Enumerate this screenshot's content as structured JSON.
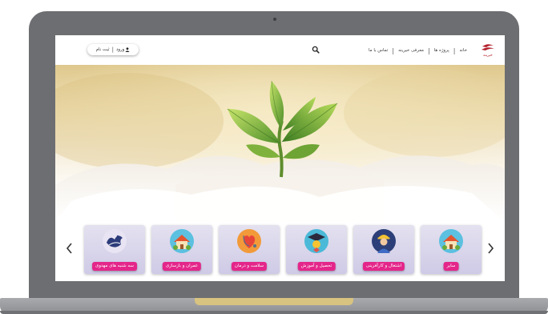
{
  "header": {
    "nav": {
      "home": "خانه",
      "projects": "پروژه ها",
      "about": "معرفی خیرینه",
      "contact": "تماس با ما"
    },
    "auth": {
      "login": "ورود",
      "separator": "|",
      "register": "ثبت نام"
    },
    "logo_text": "خیرینه"
  },
  "hero": {
    "image": "sprout-in-soil"
  },
  "categories": [
    {
      "label": "سایر",
      "icon": "house-icon"
    },
    {
      "label": "اشتغال و کارآفرینی",
      "icon": "worker-icon"
    },
    {
      "label": "تحصیل و آموزش",
      "icon": "graduation-icon"
    },
    {
      "label": "سلامت و درمان",
      "icon": "health-heart-icon"
    },
    {
      "label": "عمران و بازسازی",
      "icon": "house-icon"
    },
    {
      "label": "سه شنبه های مهدوی",
      "icon": "mahdavi-calligraphy-icon"
    }
  ],
  "colors": {
    "accent": "#e4268a",
    "card_bg": "#d8d4ea",
    "laptop": "#6d6e71",
    "base_notch": "#d8c380"
  }
}
